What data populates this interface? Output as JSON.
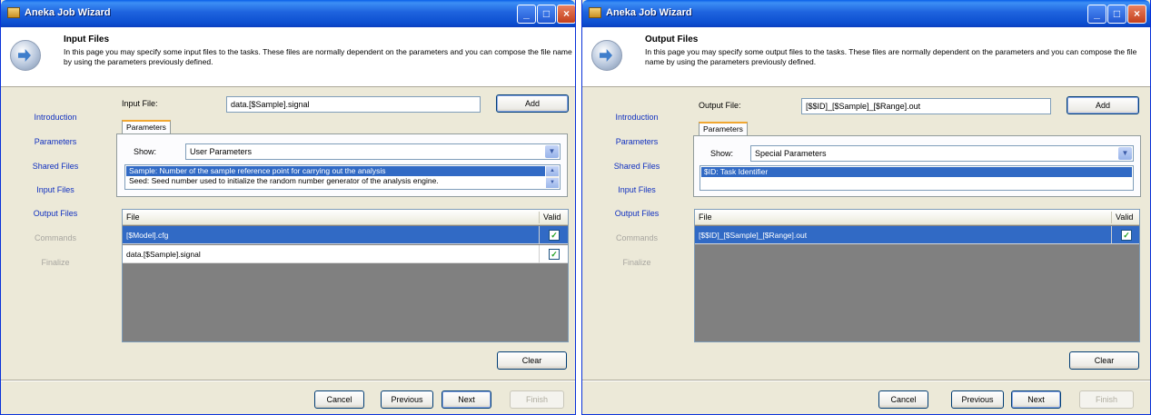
{
  "windows": [
    {
      "title": "Aneka Job Wizard",
      "header": {
        "title": "Input Files",
        "description": "In this page you may specify some input files to the tasks. These files are normally dependent on the parameters and you can compose the file name by using the parameters previously defined."
      },
      "nav": [
        "Introduction",
        "Parameters",
        "Shared Files",
        "Input Files",
        "Output Files",
        "Commands",
        "Finalize"
      ],
      "file_label": "Input File:",
      "file_value": "data.[$Sample].signal",
      "add_label": "Add",
      "tab_label": "Parameters",
      "show_label": "Show:",
      "show_value": "User Parameters",
      "param_items": [
        "Sample: Number of the sample reference point for carrying out the analysis",
        "Seed: Seed number used to initialize the random number generator of the analysis engine."
      ],
      "grid_headers": {
        "file": "File",
        "valid": "Valid"
      },
      "grid_rows": [
        {
          "file": "[$Model].cfg",
          "valid": true,
          "selected": true
        },
        {
          "file": "data.[$Sample].signal",
          "valid": true,
          "selected": false
        }
      ],
      "clear_label": "Clear",
      "buttons": {
        "cancel": "Cancel",
        "previous": "Previous",
        "next": "Next",
        "finish": "Finish"
      },
      "window_controls": {
        "minimize": "_",
        "maximize": "□",
        "close": "×"
      }
    },
    {
      "title": "Aneka Job Wizard",
      "header": {
        "title": "Output Files",
        "description": "In this page you may specify some output files to the tasks. These files are normally dependent on the parameters and you can compose the file name by using the parameters previously defined."
      },
      "nav": [
        "Introduction",
        "Parameters",
        "Shared Files",
        "Input Files",
        "Output Files",
        "Commands",
        "Finalize"
      ],
      "file_label": "Output File:",
      "file_value": "[$$ID]_[$Sample]_[$Range].out",
      "add_label": "Add",
      "tab_label": "Parameters",
      "show_label": "Show:",
      "show_value": "Special Parameters",
      "param_items": [
        "$ID: Task Identifier"
      ],
      "grid_headers": {
        "file": "File",
        "valid": "Valid"
      },
      "grid_rows": [
        {
          "file": "[$$ID]_[$Sample]_[$Range].out",
          "valid": true,
          "selected": true
        }
      ],
      "clear_label": "Clear",
      "buttons": {
        "cancel": "Cancel",
        "previous": "Previous",
        "next": "Next",
        "finish": "Finish"
      },
      "window_controls": {
        "minimize": "_",
        "maximize": "□",
        "close": "×"
      }
    }
  ],
  "colors": {
    "titlebar": "#0c4fd0",
    "selection": "#316ac5",
    "nav_link": "#1030c0",
    "window_bg": "#ece9d8",
    "tab_accent": "#f1a731",
    "grid_empty": "#808080"
  }
}
